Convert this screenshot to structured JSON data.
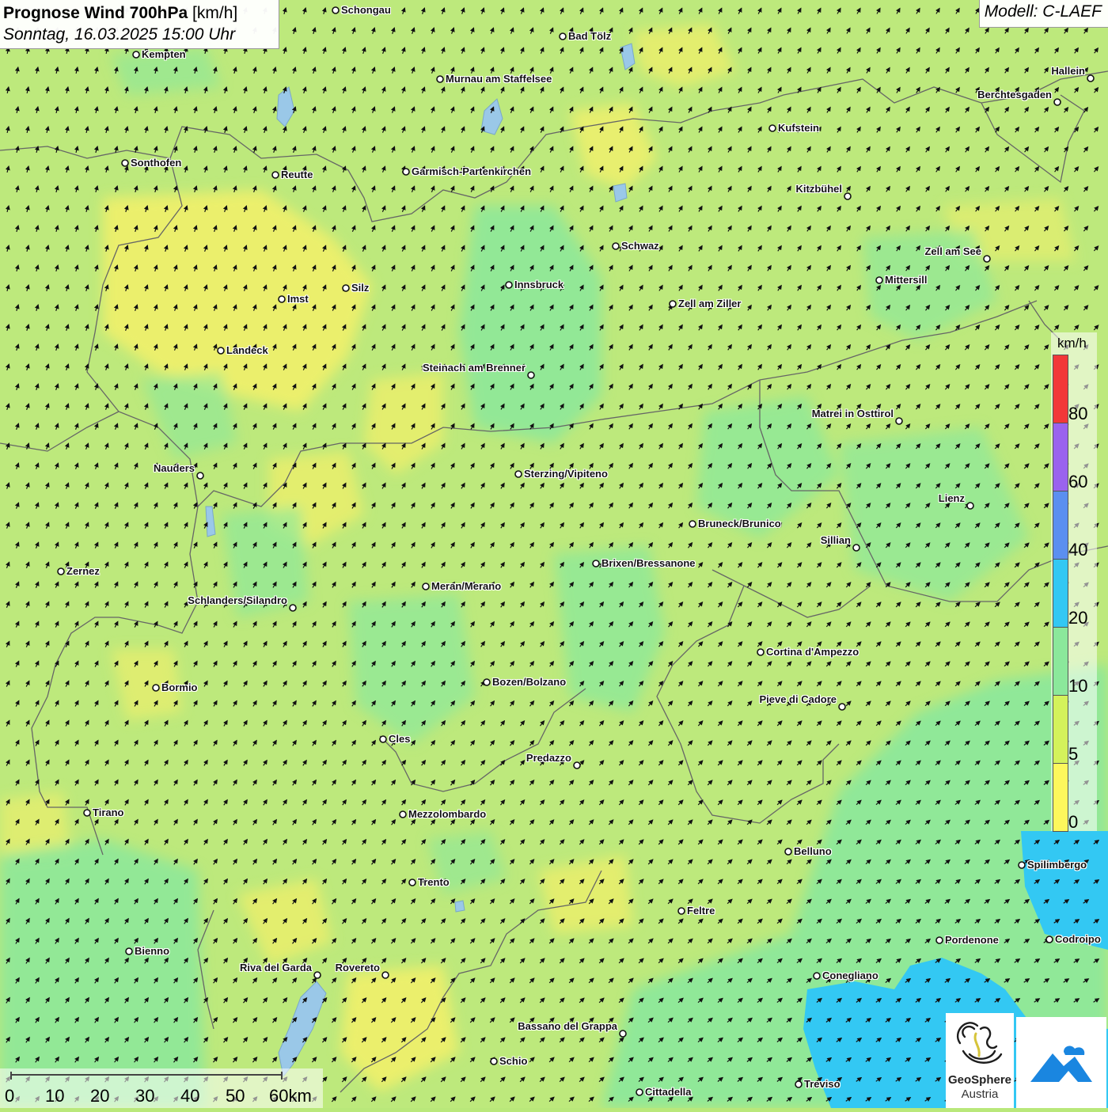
{
  "header": {
    "title_bold": "Prognose Wind 700hPa",
    "title_unit": "[km/h]",
    "subtitle": "Sonntag, 16.03.2025 15:00 Uhr",
    "model": "Modell: C-LAEF"
  },
  "legend": {
    "unit": "km/h",
    "bands": [
      {
        "label": "0",
        "color": "#fdf75c"
      },
      {
        "label": "5",
        "color": "#d4f25b"
      },
      {
        "label": "10",
        "color": "#8be89b"
      },
      {
        "label": "20",
        "color": "#33c8f3"
      },
      {
        "label": "40",
        "color": "#5b8ff0"
      },
      {
        "label": "60",
        "color": "#9a63ee"
      },
      {
        "label": "80",
        "color": "#f23838"
      }
    ]
  },
  "scale_bar": {
    "labels": [
      "0",
      "10",
      "20",
      "30",
      "40",
      "50",
      "60km"
    ]
  },
  "logos": {
    "geosphere_line1": "GeoSphere",
    "geosphere_line2": "Austria"
  },
  "cities": [
    "Schongau",
    "Bad Tölz",
    "Kempten",
    "Murnau am Staffelsee",
    "Hallein",
    "Berchtesgaden",
    "Kufstein",
    "Sonthofen",
    "Reutte",
    "Garmisch-Partenkirchen",
    "Kitzbühel",
    "Schwaz",
    "Zell am See",
    "Mittersill",
    "Innsbruck",
    "Imst",
    "Silz",
    "Zell am Ziller",
    "Landeck",
    "Steinach am Brenner",
    "Matrei in Osttirol",
    "Nauders",
    "Sterzing/Vipiteno",
    "Lienz",
    "Bruneck/Brunico",
    "Sillian",
    "Brixen/Bressanone",
    "Zernez",
    "Meran/Merano",
    "Schlanders/Silandro",
    "Cortina d'Ampezzo",
    "Bozen/Bolzano",
    "Bormio",
    "Pieve di Cadore",
    "Cles",
    "Predazzo",
    "Tirano",
    "Mezzolombardo",
    "Belluno",
    "Spilimbergo",
    "Trento",
    "Feltre",
    "Pordenone",
    "Codroipo",
    "Bienno",
    "Riva del Garda",
    "Rovereto",
    "Conegliano",
    "Bassano del Grappa",
    "Schio",
    "Treviso",
    "Cittadella"
  ]
}
